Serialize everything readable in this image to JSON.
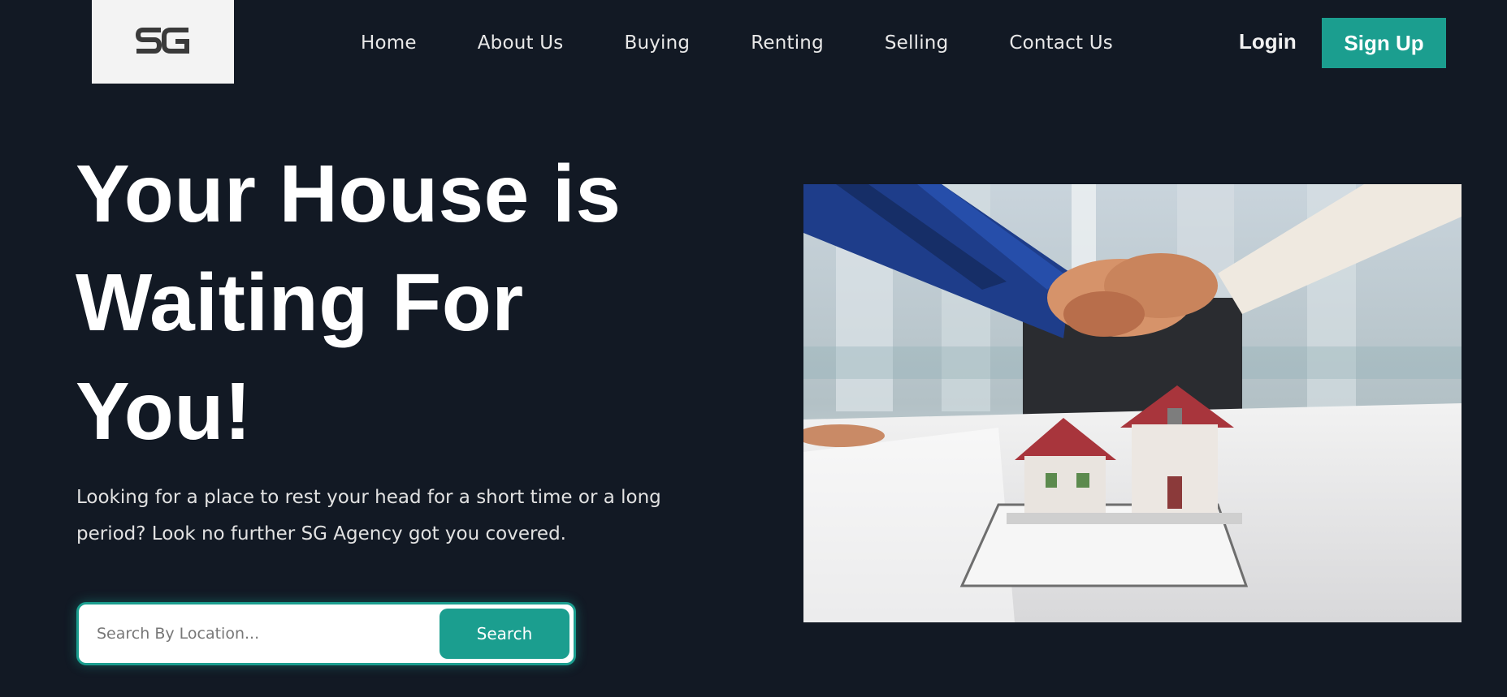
{
  "brand": {
    "logo_text": "SG"
  },
  "nav": {
    "items": [
      "Home",
      "About Us",
      "Buying",
      "Renting",
      "Selling",
      "Contact Us"
    ]
  },
  "auth": {
    "login_label": "Login",
    "signup_label": "Sign Up"
  },
  "hero": {
    "headline_line1": "Your House is",
    "headline_line2": "Waiting For",
    "headline_line3": "You!",
    "subtext": "Looking for a place to rest your head for a short time or a long period? Look no further SG Agency got you covered."
  },
  "search": {
    "placeholder": "Search By Location...",
    "button_label": "Search"
  },
  "colors": {
    "background": "#121924",
    "accent": "#1b9e8f",
    "logo_bg": "#f3f3f3"
  },
  "image": {
    "subject": "handshake-over-house-model"
  }
}
